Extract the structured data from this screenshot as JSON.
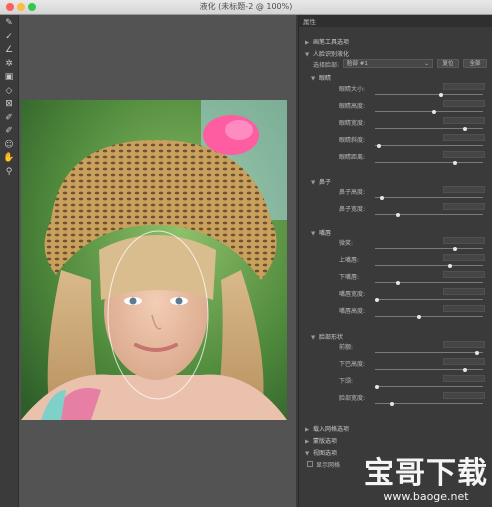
{
  "window": {
    "title": "液化 (未标题-2 @ 100%)"
  },
  "toolbar": {
    "tools": [
      {
        "icon": "forward-warp-icon",
        "glyph": "✎"
      },
      {
        "icon": "reconstruct-icon",
        "glyph": "✓"
      },
      {
        "icon": "smooth-icon",
        "glyph": "∠"
      },
      {
        "icon": "twirl-icon",
        "glyph": "✲"
      },
      {
        "icon": "pucker-icon",
        "glyph": "▣"
      },
      {
        "icon": "bloat-icon",
        "glyph": "◇"
      },
      {
        "icon": "push-left-icon",
        "glyph": "⊠"
      },
      {
        "icon": "freeze-mask-icon",
        "glyph": "✐"
      },
      {
        "icon": "thaw-mask-icon",
        "glyph": "✐"
      },
      {
        "icon": "face-tool-icon",
        "glyph": "☺"
      },
      {
        "icon": "hand-icon",
        "glyph": "✋"
      },
      {
        "icon": "zoom-icon",
        "glyph": "⚲"
      }
    ]
  },
  "panel": {
    "header": "属性",
    "sections": {
      "brush_tool": "画笔工具选项",
      "face_aware": "人脸识别液化",
      "eyes": "眼睛",
      "nose": "鼻子",
      "mouth": "嘴唇",
      "face_shape": "脸部形状",
      "load_mesh": "载入网格选项",
      "mask": "蒙版选项",
      "view": "视图选项"
    },
    "face_select": {
      "label": "选择脸部:",
      "value": "脸部 #1",
      "reset": "复位",
      "all": "全部"
    },
    "eyes_rows": [
      {
        "label": "眼睛大小:",
        "value": 0.62
      },
      {
        "label": "眼睛高度:",
        "value": 0.55
      },
      {
        "label": "眼睛宽度:",
        "value": 0.85
      },
      {
        "label": "眼睛斜度:",
        "value": 0.02
      },
      {
        "label": "眼睛距离:",
        "value": 0.75
      }
    ],
    "nose_rows": [
      {
        "label": "鼻子高度:",
        "value": 0.05
      },
      {
        "label": "鼻子宽度:",
        "value": 0.2
      }
    ],
    "mouth_rows": [
      {
        "label": "微笑:",
        "value": 0.75
      },
      {
        "label": "上嘴唇:",
        "value": 0.7
      },
      {
        "label": "下嘴唇:",
        "value": 0.2
      },
      {
        "label": "嘴唇宽度:",
        "value": 0.0
      },
      {
        "label": "嘴唇高度:",
        "value": 0.4
      }
    ],
    "face_rows": [
      {
        "label": "前额:",
        "value": 0.96
      },
      {
        "label": "下巴高度:",
        "value": 0.85
      },
      {
        "label": "下颌:",
        "value": 0.0
      },
      {
        "label": "脸部宽度:",
        "value": 0.14
      }
    ],
    "show_mesh": "显示网格"
  },
  "watermark": {
    "title": "宝哥下载",
    "url": "www.baoge.net"
  }
}
